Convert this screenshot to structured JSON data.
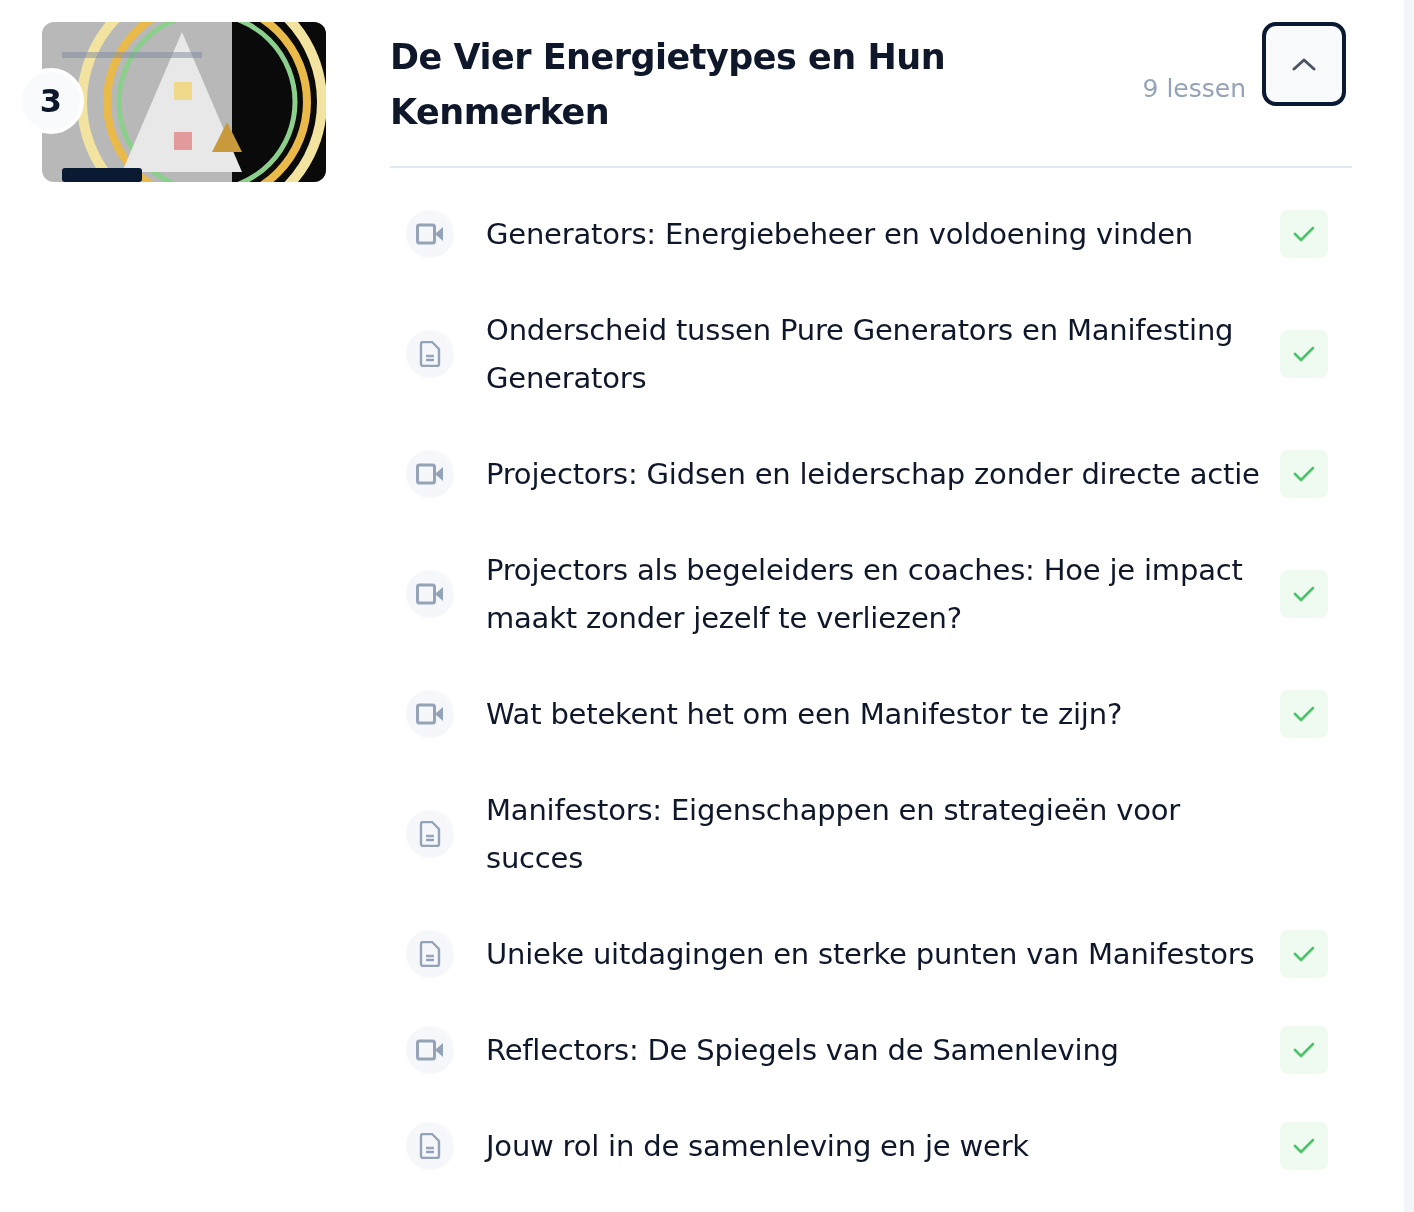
{
  "module": {
    "number": "3",
    "title": "De Vier Energietypes en Hun Kenmerken",
    "lesson_count": "9 lessen",
    "expanded": true
  },
  "lessons": [
    {
      "kind": "video",
      "title": "Generators: Energiebeheer en voldoening vinden",
      "completed": true
    },
    {
      "kind": "document",
      "title": "Onderscheid tussen Pure Generators en Manifesting Generators",
      "completed": true
    },
    {
      "kind": "video",
      "title": "Projectors: Gidsen en leiderschap zonder directe actie",
      "completed": true
    },
    {
      "kind": "video",
      "title": "Projectors als begeleiders en coaches: Hoe je impact maakt zonder jezelf te verliezen?",
      "completed": true
    },
    {
      "kind": "video",
      "title": "Wat betekent het om een Manifestor te zijn?",
      "completed": true
    },
    {
      "kind": "document",
      "title": "Manifestors: Eigenschappen en strategieën voor succes",
      "completed": false
    },
    {
      "kind": "document",
      "title": "Unieke uitdagingen en sterke punten van Manifestors",
      "completed": true
    },
    {
      "kind": "video",
      "title": "Reflectors: De Spiegels van de Samenleving",
      "completed": true
    },
    {
      "kind": "document",
      "title": "Jouw rol in de samenleving en je werk",
      "completed": true
    }
  ]
}
